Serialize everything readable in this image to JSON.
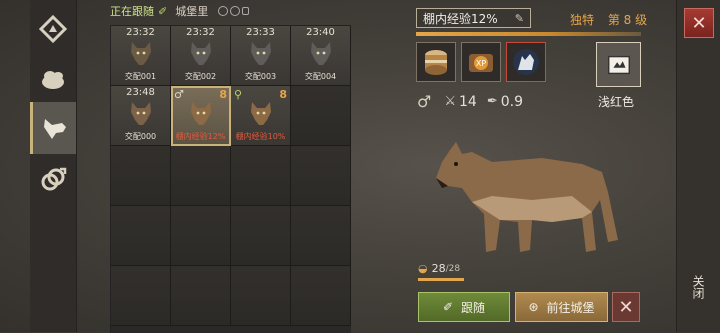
{
  "header": {
    "following": "正在跟随",
    "castle": "城堡里"
  },
  "grid": {
    "cells": [
      {
        "time": "23:32",
        "name": "交配001",
        "state": "filled",
        "fur": "#6b5a44"
      },
      {
        "time": "23:32",
        "name": "交配002",
        "state": "filled",
        "fur": "#5f5d5a"
      },
      {
        "time": "23:33",
        "name": "交配003",
        "state": "filled",
        "fur": "#5f5d5a"
      },
      {
        "time": "23:40",
        "name": "交配004",
        "state": "filled",
        "fur": "#5f5d5a"
      },
      {
        "time": "23:48",
        "name": "交配000",
        "state": "filled",
        "fur": "#7b6248"
      },
      {
        "level": "8",
        "name": "棚内经验12%",
        "state": "sel",
        "mark": "male",
        "fur": "#8c6a45"
      },
      {
        "level": "8",
        "name": "棚内经验10%",
        "state": "filled",
        "mark": "search-feather",
        "fur": "#8c6a45"
      }
    ]
  },
  "detail": {
    "title": "棚内经验12%",
    "rarity": "独特",
    "level_text": "第 8 级",
    "stat_attack": "14",
    "stat_speed": "0.9",
    "color_name": "浅红色",
    "food": "28",
    "food_max": "/28",
    "food_fraction": 1.0
  },
  "buttons": {
    "follow": "跟随",
    "go_castle": "前往城堡",
    "close_side": "关闭"
  },
  "colors": {
    "accent": "#e5a54a",
    "follow_green": "#6f8a3a",
    "go_brown": "#b08a4f"
  }
}
